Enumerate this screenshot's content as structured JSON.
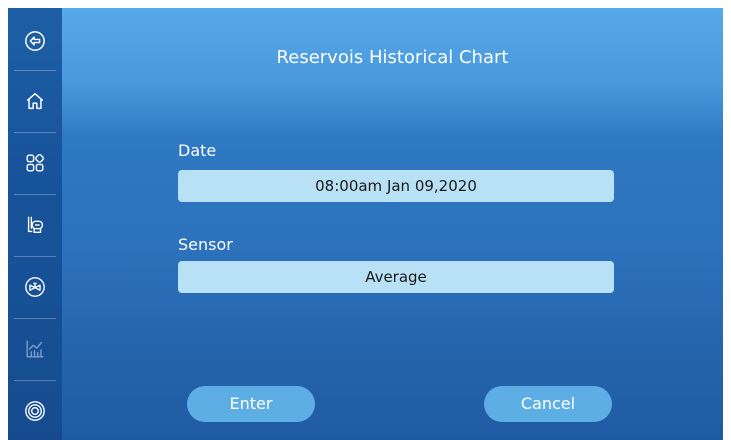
{
  "window": {
    "title": "Reservois Historical Chart"
  },
  "sidebar": {
    "items": [
      {
        "icon": "back-arrow-icon"
      },
      {
        "icon": "home-icon"
      },
      {
        "icon": "apps-grid-icon"
      },
      {
        "icon": "pump-device-icon"
      },
      {
        "icon": "valve-gauge-icon"
      },
      {
        "icon": "chart-icon"
      },
      {
        "icon": "target-icon"
      }
    ]
  },
  "form": {
    "date_label": "Date",
    "date_value": "08:00am  Jan 09,2020",
    "sensor_label": "Sensor",
    "sensor_value": "Average"
  },
  "actions": {
    "enter_label": "Enter",
    "cancel_label": "Cancel"
  },
  "colors": {
    "sidebar_bg": "#1a579f",
    "header_bg": "#4b9ddf",
    "main_bg": "#2c72bc",
    "field_bg": "#b9e1f6",
    "button_bg": "#5eaee6"
  }
}
